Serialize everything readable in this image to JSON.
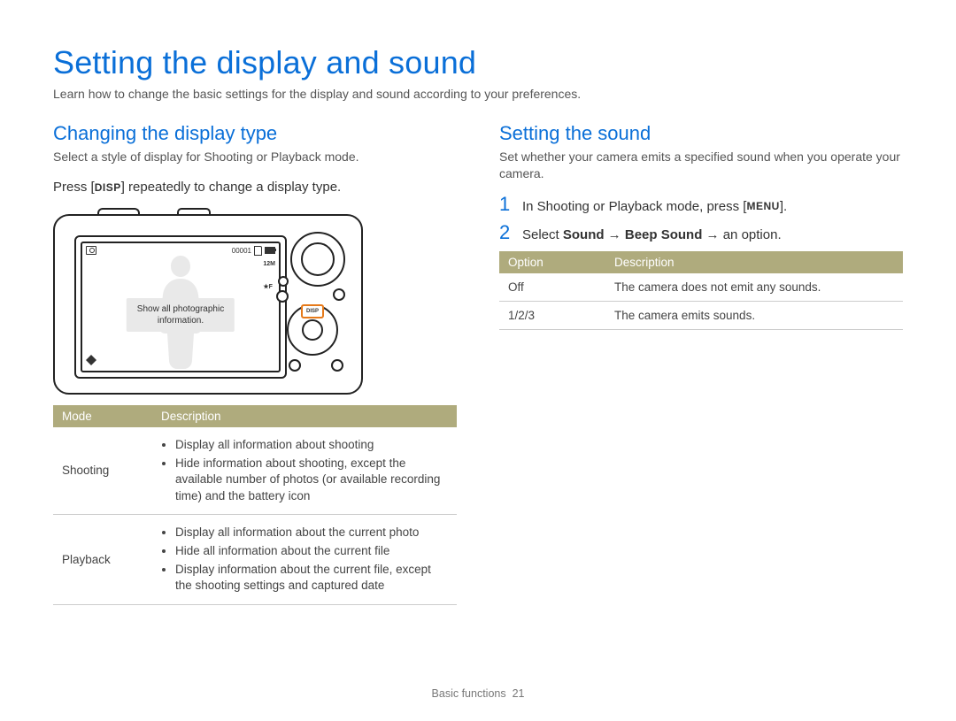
{
  "page_title": "Setting the display and sound",
  "intro": "Learn how to change the basic settings for the display and sound according to your preferences.",
  "left": {
    "heading": "Changing the display type",
    "sub": "Select a style of display for Shooting or Playback mode.",
    "instr_pre": "Press [",
    "disp_label": "DISP",
    "instr_post": "] repeatedly to change a display type.",
    "camera_overlay_l1": "Show all photographic",
    "camera_overlay_l2": "information.",
    "screen": {
      "counter": "00001",
      "q1": "12M",
      "q2": "★F",
      "disp_btn": "DISP"
    },
    "table": {
      "h1": "Mode",
      "h2": "Description",
      "rows": [
        {
          "mode": "Shooting",
          "items": [
            "Display all information about shooting",
            "Hide information about shooting, except the available number of photos (or available recording time) and the battery icon"
          ]
        },
        {
          "mode": "Playback",
          "items": [
            "Display all information about the current photo",
            "Hide all information about the current file",
            "Display information about the current file, except the shooting settings and captured date"
          ]
        }
      ]
    }
  },
  "right": {
    "heading": "Setting the sound",
    "sub": "Set whether your camera emits a specified sound when you operate your camera.",
    "steps": [
      {
        "num": "1",
        "pre": "In Shooting or Playback mode, press [",
        "menu_label": "MENU",
        "post": "]."
      },
      {
        "num": "2",
        "pre": "Select ",
        "b1": "Sound",
        "arrow1": " → ",
        "b2": "Beep Sound",
        "arrow2": " → ",
        "post": "an option."
      }
    ],
    "table": {
      "h1": "Option",
      "h2": "Description",
      "rows": [
        {
          "opt": "Off",
          "desc": "The camera does not emit any sounds."
        },
        {
          "opt": "1/2/3",
          "desc": "The camera emits sounds."
        }
      ]
    }
  },
  "footer_section": "Basic functions",
  "footer_page": "21"
}
